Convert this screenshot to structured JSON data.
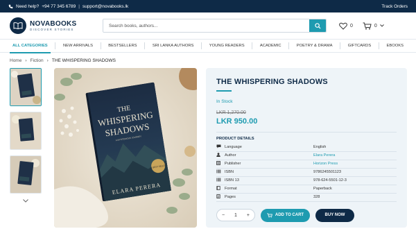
{
  "topbar": {
    "help_label": "Need help?",
    "phone": "+94 77 345 6789",
    "email": "support@novabooks.lk",
    "track_orders": "Track Orders"
  },
  "brand": {
    "name": "NOVABOOKS",
    "tagline": "DISCOVER STORIES"
  },
  "search": {
    "placeholder": "Search books, authors..."
  },
  "header": {
    "wishlist_count": "0",
    "cart_count": "0"
  },
  "nav": {
    "items": [
      {
        "label": "ALL CATEGORIES",
        "active": true
      },
      {
        "label": "NEW ARRIVALS"
      },
      {
        "label": "BESTSELLERS"
      },
      {
        "label": "SRI LANKA AUTHORS"
      },
      {
        "label": "YOUNG READERS"
      },
      {
        "label": "ACADEMIC"
      },
      {
        "label": "POETRY & DRAMA"
      },
      {
        "label": "GIFTCARDS"
      },
      {
        "label": "EBOOKS"
      }
    ]
  },
  "breadcrumb": {
    "home": "Home",
    "category": "Fiction",
    "current": "THE WHISPERING SHADOWS"
  },
  "book_cover": {
    "title_line1": "THE",
    "title_line2": "WHISPERING",
    "title_line3": "SHADOWS",
    "subtitle": "A MYSTERIOUS JOURNEY",
    "author": "ELARA PERERA",
    "seal_text": "#1 BEST SELLER"
  },
  "product": {
    "title": "THE WHISPERING SHADOWS",
    "stock": "In Stock",
    "old_price": "LKR 1,270.00",
    "price": "LKR 950.00",
    "details_heading": "PRODUCT DETAILS",
    "details": [
      {
        "label": "Language",
        "value": "English",
        "icon": "language-icon"
      },
      {
        "label": "Author",
        "value": "Elara Perera",
        "icon": "user-icon",
        "link": true
      },
      {
        "label": "Publisher",
        "value": "Horizon Press",
        "icon": "publisher-icon",
        "link": true
      },
      {
        "label": "ISBN",
        "value": "9786245501123",
        "icon": "barcode-icon"
      },
      {
        "label": "ISBN 13",
        "value": "978-624-5501-12-3",
        "icon": "barcode-icon"
      },
      {
        "label": "Format",
        "value": "Paperback",
        "icon": "book-icon"
      },
      {
        "label": "Pages",
        "value": "328",
        "icon": "pages-icon"
      }
    ],
    "quantity": "1",
    "add_to_cart": "ADD TO CART",
    "buy_now": "BUY NOW"
  },
  "colors": {
    "primary": "#0e2a47",
    "accent": "#1e9bb0",
    "panel": "#eef4f8"
  }
}
